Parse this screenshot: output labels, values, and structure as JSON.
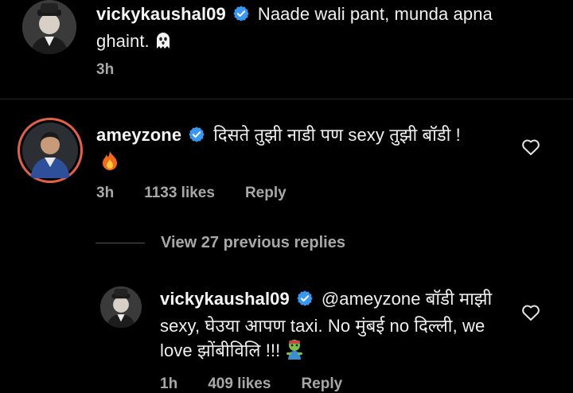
{
  "comments": [
    {
      "username": "vickykaushal09",
      "verified": true,
      "text": "Naade wali pant, munda apna ghaint.",
      "emoji": "ghost-emoji",
      "time": "3h"
    },
    {
      "username": "ameyzone",
      "verified": true,
      "text": "दिसते तुझी नाडी पण sexy तुझी बॉडी !",
      "emoji": "fire-emoji",
      "time": "3h",
      "likes": "1133 likes",
      "reply_label": "Reply"
    }
  ],
  "view_replies_label": "View 27 previous replies",
  "reply": {
    "username": "vickykaushal09",
    "verified": true,
    "text": "@ameyzone बॉडी माझी sexy, घेउया आपण taxi. No मुंबई no दिल्ली, we love झोंबीविलि !!!",
    "emoji": "zombie-emoji",
    "time": "1h",
    "likes": "409 likes",
    "reply_label": "Reply"
  },
  "colors": {
    "background": "#000000",
    "verified_badge": "#3897f0",
    "muted_text": "#a8a8a8",
    "avatar_ring": "#e0604a"
  }
}
